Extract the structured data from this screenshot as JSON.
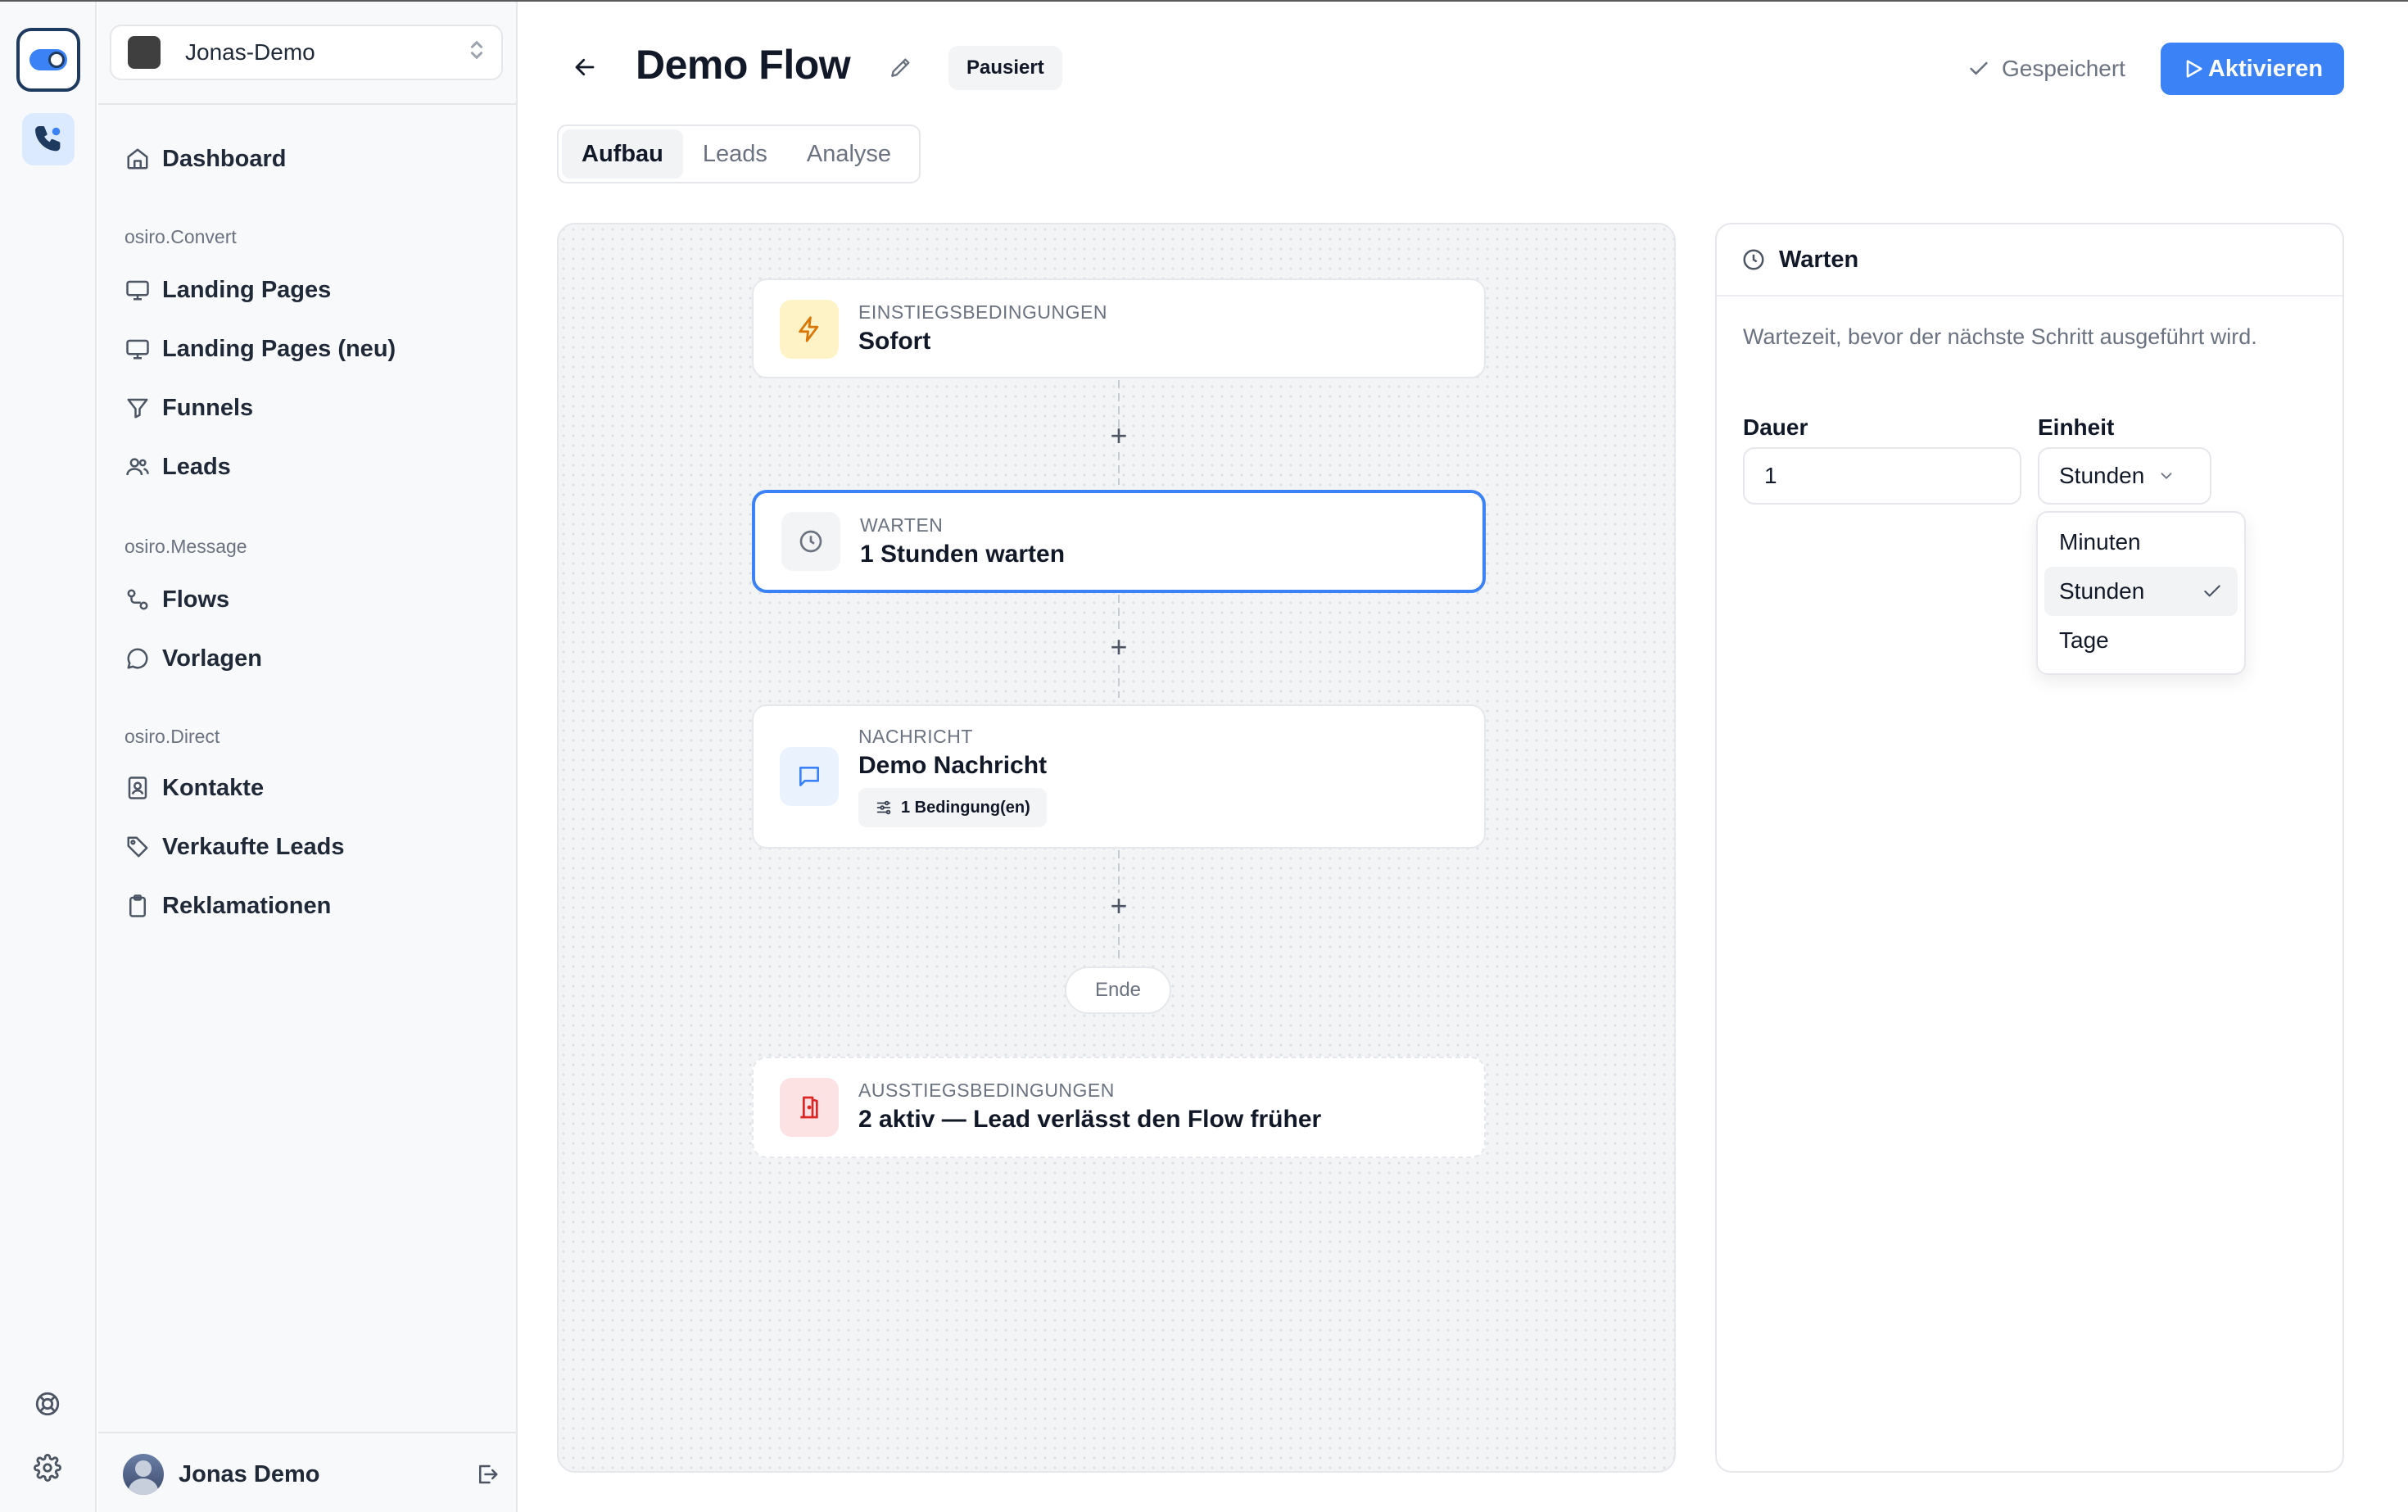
{
  "colors": {
    "accent": "#3b82f6",
    "badge_bg": "#f3f4f6",
    "lightning_bg": "#fef3c7",
    "exit_bg": "#fde2e4",
    "message_bg": "#e0ecfd"
  },
  "rail": {
    "icons": [
      "app-logo-icon",
      "phone-icon",
      "help-buoy-icon",
      "gear-icon"
    ]
  },
  "workspace": {
    "name": "Jonas-Demo"
  },
  "sidebar": {
    "top_items": [
      {
        "label": "Dashboard",
        "icon": "home-icon"
      }
    ],
    "sections": [
      {
        "title": "osiro.Convert",
        "items": [
          {
            "label": "Landing Pages",
            "icon": "monitor-icon"
          },
          {
            "label": "Landing Pages (neu)",
            "icon": "monitor-icon"
          },
          {
            "label": "Funnels",
            "icon": "funnel-icon"
          },
          {
            "label": "Leads",
            "icon": "users-icon"
          }
        ]
      },
      {
        "title": "osiro.Message",
        "items": [
          {
            "label": "Flows",
            "icon": "flow-icon"
          },
          {
            "label": "Vorlagen",
            "icon": "chat-bubble-icon"
          }
        ]
      },
      {
        "title": "osiro.Direct",
        "items": [
          {
            "label": "Kontakte",
            "icon": "contact-book-icon"
          },
          {
            "label": "Verkaufte Leads",
            "icon": "tag-icon"
          },
          {
            "label": "Reklamationen",
            "icon": "clipboard-icon"
          }
        ]
      }
    ],
    "user": {
      "name": "Jonas Demo"
    }
  },
  "header": {
    "title": "Demo Flow",
    "status_badge": "Pausiert",
    "saved_label": "Gespeichert",
    "activate_label": "Aktivieren"
  },
  "tabs": [
    {
      "label": "Aufbau",
      "active": true
    },
    {
      "label": "Leads",
      "active": false
    },
    {
      "label": "Analyse",
      "active": false
    }
  ],
  "flow": {
    "entry": {
      "caption": "EINSTIEGSBEDINGUNGEN",
      "title": "Sofort",
      "icon": "lightning-icon"
    },
    "wait": {
      "caption": "WARTEN",
      "title": "1 Stunden warten",
      "icon": "clock-icon"
    },
    "message": {
      "caption": "NACHRICHT",
      "title": "Demo Nachricht",
      "icon": "message-icon",
      "condition_chip": "1 Bedingung(en)"
    },
    "add_symbol": "+",
    "end_label": "Ende",
    "exit": {
      "caption": "AUSSTIEGSBEDINGUNGEN",
      "title": "2 aktiv — Lead verlässt den Flow früher",
      "icon": "door-exit-icon"
    }
  },
  "panel": {
    "title": "Warten",
    "description": "Wartezeit, bevor der nächste Schritt ausgeführt wird.",
    "duration_label": "Dauer",
    "duration_value": "1",
    "unit_label": "Einheit",
    "unit_value": "Stunden",
    "unit_options": [
      "Minuten",
      "Stunden",
      "Tage"
    ],
    "unit_selected_index": 1
  }
}
